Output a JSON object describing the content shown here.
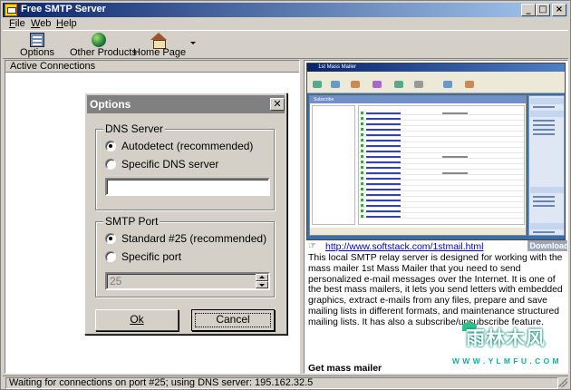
{
  "window": {
    "title": "Free SMTP Server",
    "minimize": "_",
    "maximize": "□",
    "close": "×"
  },
  "menu": [
    "File",
    "Web",
    "Help"
  ],
  "toolbar": {
    "options": "Options",
    "other_products": "Other Products",
    "home_page": "Home Page"
  },
  "connections": {
    "header": "Active Connections"
  },
  "dialog": {
    "title": "Options",
    "close": "✕",
    "dns": {
      "title": "DNS Server",
      "autodetect": "Autodetect (recommended)",
      "specific": "Specific DNS server",
      "server_value": "",
      "selected": "autodetect"
    },
    "port": {
      "title": "SMTP Port",
      "standard": "Standard #25 (recommended)",
      "specific": "Specific port",
      "port_value": "25",
      "selected": "standard"
    },
    "ok": "Ok",
    "cancel": "Cancel"
  },
  "promo": {
    "screenshot_title": "1st Mass Mailer",
    "screenshot_caption": "Subscribe",
    "link_icon": "☞",
    "link": "http://www.softstack.com/1stmail.html",
    "download": "Download",
    "description": "This local SMTP relay server is designed for working with the mass mailer 1st Mass Mailer that you need to send personalized e-mail messages over the Internet. It is one of the best mass mailers, it lets you send letters with embedded graphics, extract e-mails from any files, prepare and save mailing lists in different formats, and maintenance structured mailing lists. It has also a subscribe/unsubscribe feature.",
    "get": "Get mass mailer"
  },
  "watermark": {
    "logo": "雨林木风",
    "url": "W W W . Y L M F U . C O M"
  },
  "status": {
    "text": "Waiting for connections on port #25; using DNS server: 195.162.32.5"
  }
}
